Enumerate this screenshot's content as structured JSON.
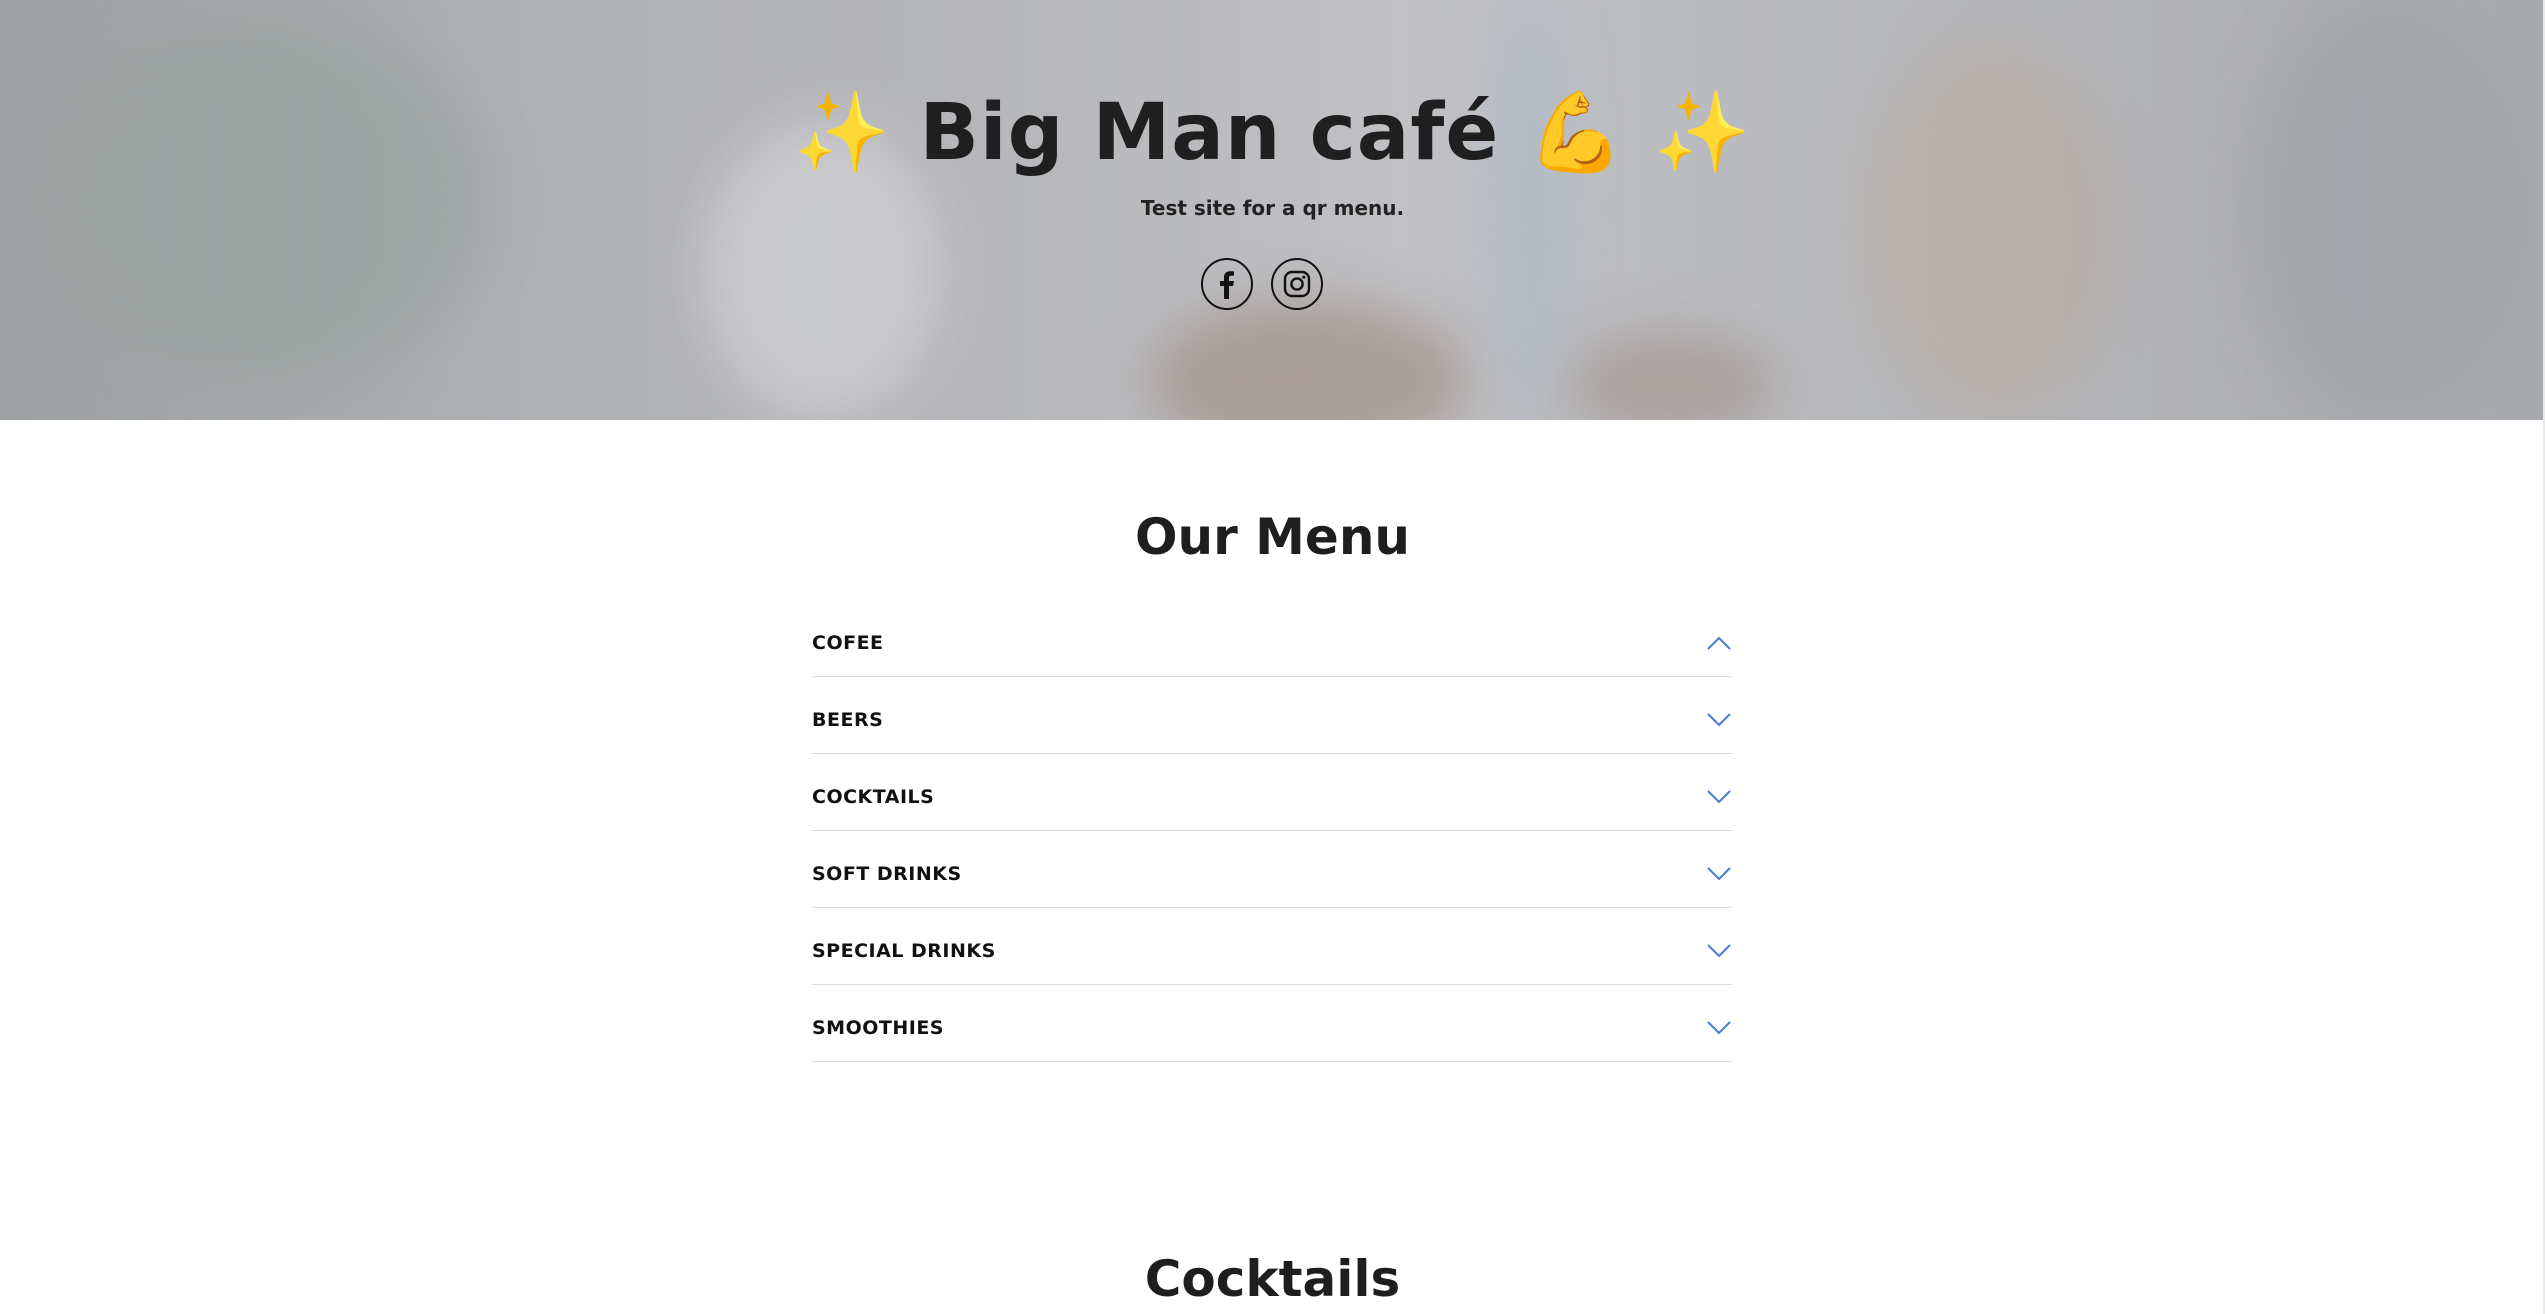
{
  "hero": {
    "title": "✨ Big Man café 💪 ✨",
    "subtitle": "Test site for a qr menu.",
    "social": [
      {
        "name": "facebook-icon"
      },
      {
        "name": "instagram-icon"
      }
    ]
  },
  "menu": {
    "heading": "Our Menu",
    "categories": [
      {
        "label": "COFEE",
        "state": "expanded"
      },
      {
        "label": "BEERS",
        "state": "collapsed"
      },
      {
        "label": "COCKTAILS",
        "state": "collapsed"
      },
      {
        "label": "SOFT DRINKS",
        "state": "collapsed"
      },
      {
        "label": "SPECIAL DRINKS",
        "state": "collapsed"
      },
      {
        "label": "SMOOTHIES",
        "state": "collapsed"
      }
    ],
    "chevron_color": "#4a7bd0"
  },
  "next_section": {
    "heading": "Cocktails"
  }
}
